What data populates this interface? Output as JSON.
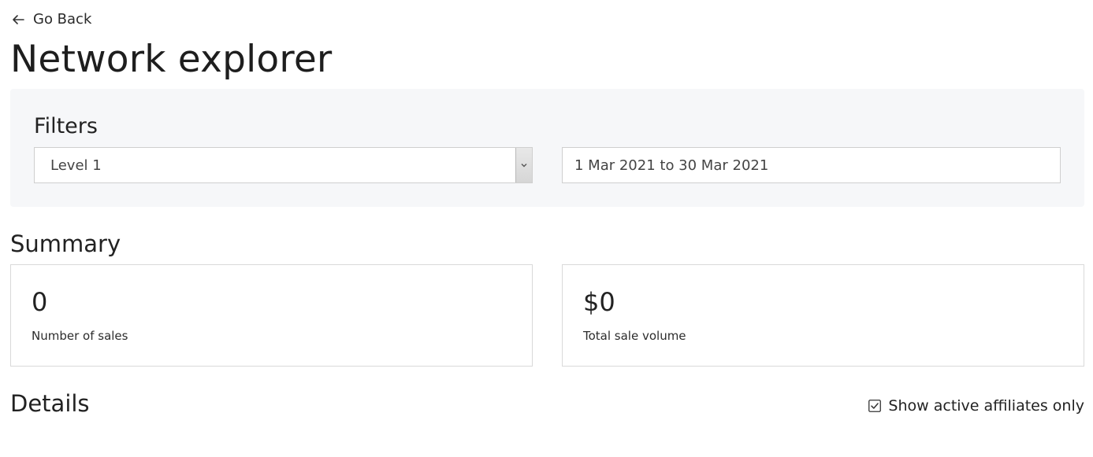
{
  "nav": {
    "back_label": "Go Back",
    "back_icon": "arrow-left-icon"
  },
  "page": {
    "title": "Network explorer"
  },
  "filters": {
    "heading": "Filters",
    "level": {
      "selected": "Level 1",
      "icon": "chevron-down-icon"
    },
    "date_range": "1 Mar 2021 to 30 Mar 2021"
  },
  "summary": {
    "heading": "Summary",
    "cards": [
      {
        "value": "0",
        "label": "Number of sales"
      },
      {
        "value": "$0",
        "label": "Total sale volume"
      }
    ]
  },
  "details": {
    "heading": "Details",
    "active_only": {
      "label": "Show active affiliates only",
      "checked": true
    }
  },
  "colors": {
    "panel_bg": "#f6f7f9",
    "border": "#d9d9d9",
    "text": "#1f1f1f"
  }
}
